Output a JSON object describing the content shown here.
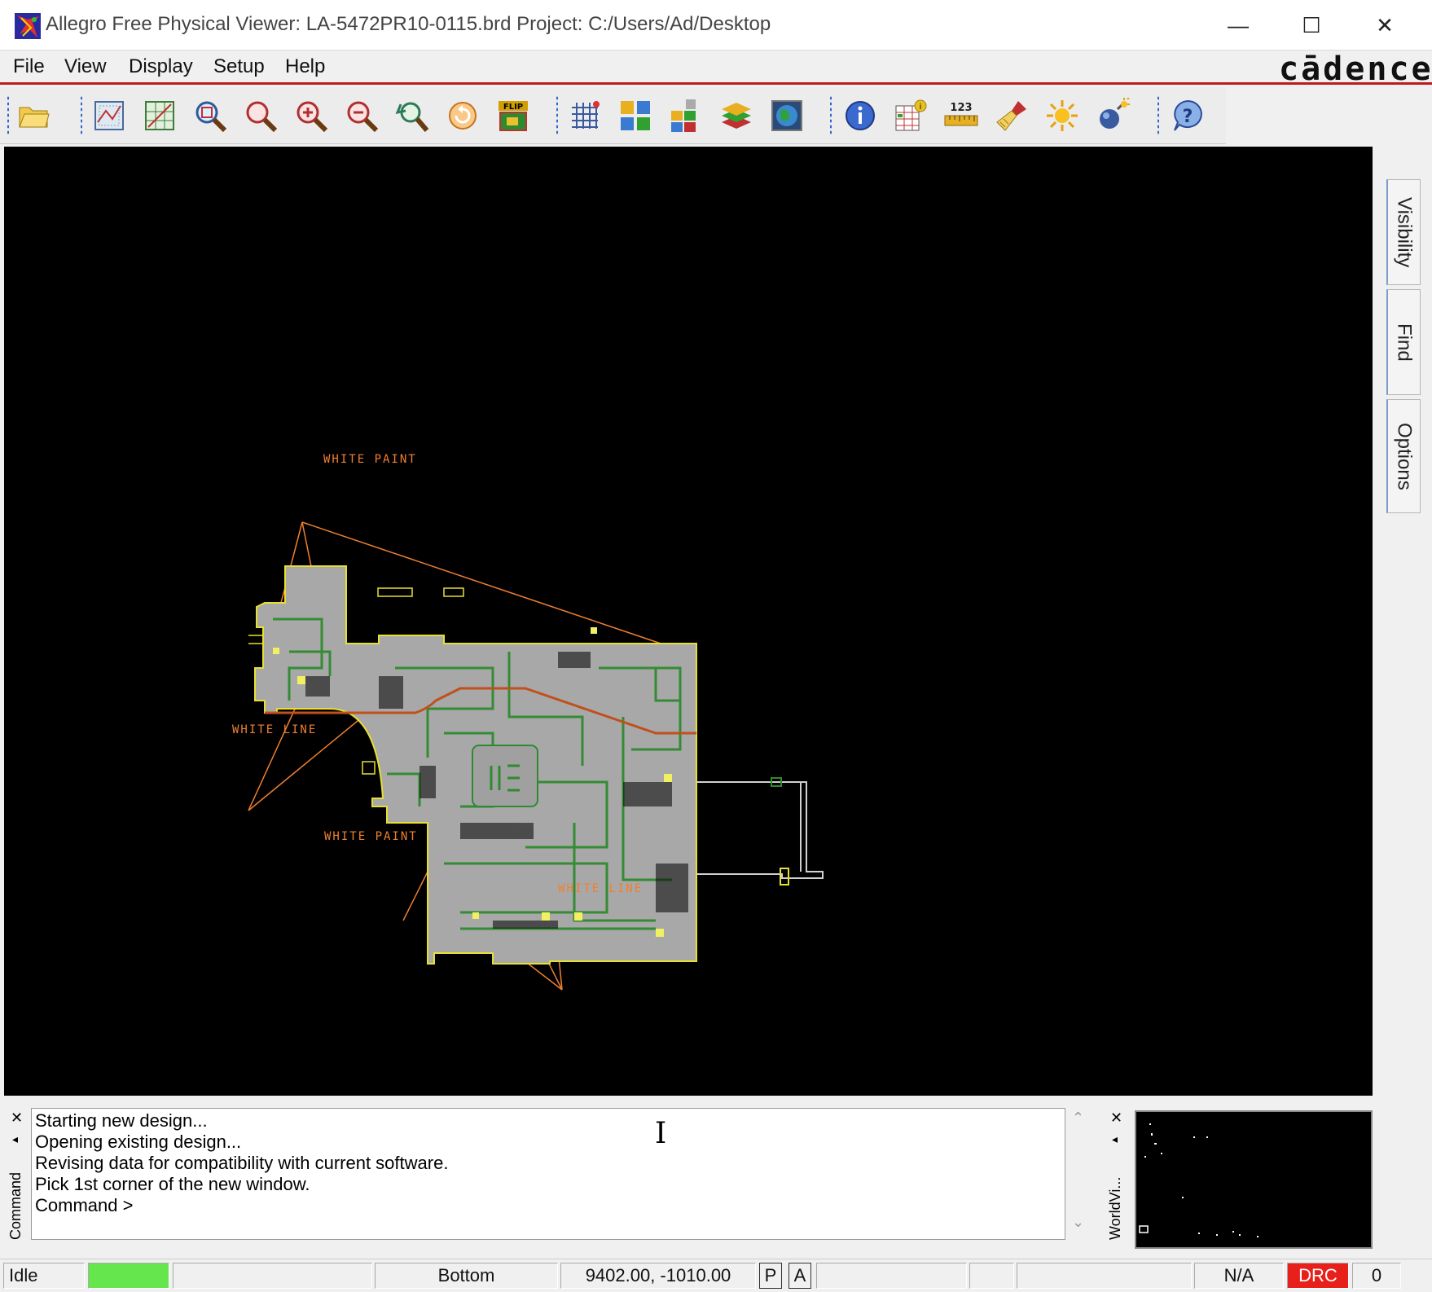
{
  "window": {
    "title": "Allegro Free Physical Viewer: LA-5472PR10-0115.brd  Project: C:/Users/Ad/Desktop",
    "minimize_glyph": "—",
    "maximize_glyph": "☐",
    "close_glyph": "✕"
  },
  "menu": {
    "items": [
      {
        "label": "File"
      },
      {
        "label": "View"
      },
      {
        "label": "Display"
      },
      {
        "label": "Setup"
      },
      {
        "label": "Help"
      }
    ],
    "brand": "cādence"
  },
  "toolbar": {
    "flip_label": "FLIP",
    "ruler_label": "123",
    "icons": [
      "open-folder-icon",
      "zoom-fit-icon",
      "zoom-grid-icon",
      "zoom-points-icon",
      "zoom-icon",
      "zoom-in-icon",
      "zoom-out-icon",
      "zoom-previous-icon",
      "redraw-icon",
      "flip-board-icon",
      "grid-icon",
      "color-icon",
      "shadow-icon",
      "layers-icon",
      "world-icon",
      "info-icon",
      "report-icon",
      "measure-icon",
      "clean-icon",
      "highlight-icon",
      "dehighlight-icon",
      "help-icon"
    ]
  },
  "board_labels": {
    "white_paint_top": "WHITE PAINT",
    "white_line_left": "WHITE LINE",
    "white_paint_bottom": "WHITE PAINT",
    "white_line_bottom": "WHITE LINE"
  },
  "side_tabs": [
    {
      "label": "Visibility"
    },
    {
      "label": "Find"
    },
    {
      "label": "Options"
    }
  ],
  "command": {
    "panel_label": "Command",
    "lines": [
      "Starting new design...",
      "Opening existing design...",
      "Revising data for compatibility with current software.",
      "Pick 1st corner of the new window.",
      "Command >"
    ]
  },
  "worldview": {
    "panel_label": "WorldVi..."
  },
  "status": {
    "state": "Idle",
    "indicator_color": "#66e64d",
    "layer": "Bottom",
    "coords": "9402.00, -1010.00",
    "p_btn": "P",
    "a_btn": "A",
    "na": "N/A",
    "drc": "DRC",
    "drc_color": "#e8201c",
    "count": "0"
  },
  "colors": {
    "accent_red": "#c0181f",
    "board_outline": "#e8e030",
    "board_fill": "#a8a8a8",
    "trace_green": "#2f8a2f",
    "label_orange": "#f08030"
  }
}
